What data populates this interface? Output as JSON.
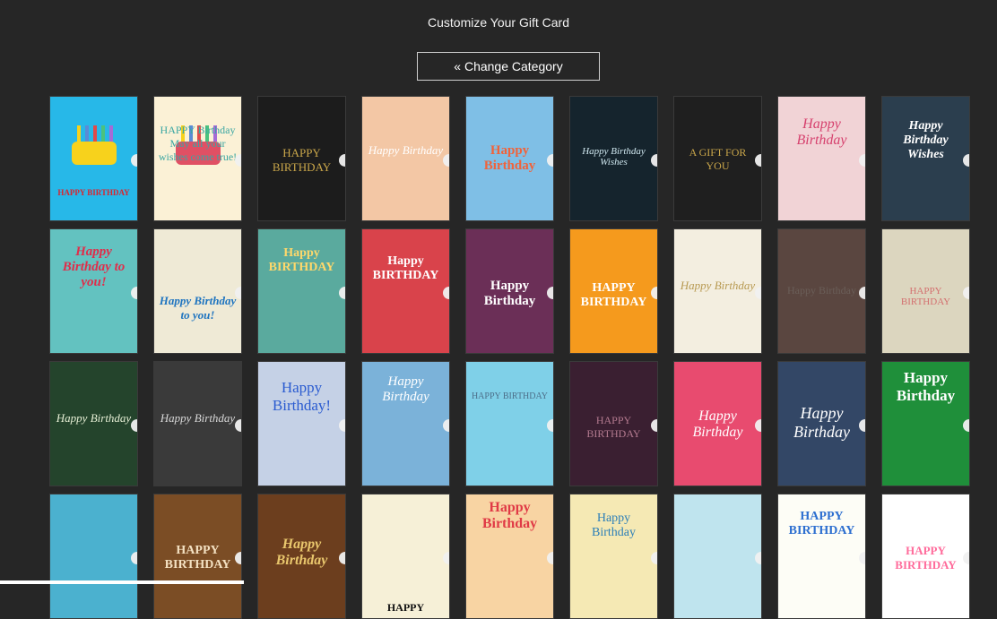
{
  "header": {
    "title": "Customize Your Gift Card"
  },
  "toolbar": {
    "change_category_label": "« Change Category"
  },
  "cards": [
    {
      "text": "HAPPY BIRTHDAY",
      "bg": "#27b8e8",
      "fg": "#d8262f",
      "font": "bold 9px",
      "top": "74%",
      "icon": "cake"
    },
    {
      "text": "HAPPY Birthday May all your wishes come true!",
      "bg": "#fbf1d6",
      "fg": "#3aa6a3",
      "font": "12px",
      "top": "22%",
      "icon": "cake2"
    },
    {
      "text": "HAPPY BIRTHDAY",
      "bg": "#1c1c1c",
      "fg": "#c9a64a",
      "font": "13px",
      "top": "40%"
    },
    {
      "text": "Happy Birthday",
      "bg": "#f3c7a5",
      "fg": "#ffffff",
      "font": "italic 13px",
      "top": "38%"
    },
    {
      "text": "Happy Birthday",
      "bg": "#7fbfe6",
      "fg": "#f0633b",
      "font": "bold 15px",
      "top": "38%"
    },
    {
      "text": "Happy Birthday Wishes",
      "bg": "#15242d",
      "fg": "#cfe7ef",
      "font": "italic 11px",
      "top": "40%"
    },
    {
      "text": "A GIFT FOR YOU",
      "bg": "#1f1f1f",
      "fg": "#c9a64a",
      "font": "12px",
      "top": "40%"
    },
    {
      "text": "Happy Birthday",
      "bg": "#f1d3d6",
      "fg": "#d6416e",
      "font": "italic 16px",
      "top": "16%"
    },
    {
      "text": "Happy Birthday Wishes",
      "bg": "#2b3e4e",
      "fg": "#ffffff",
      "font": "italic bold 14px",
      "top": "18%"
    },
    {
      "text": "Happy Birthday to you!",
      "bg": "#63c2c0",
      "fg": "#e02d4a",
      "font": "italic bold 15px",
      "top": "12%"
    },
    {
      "text": "Happy Birthday to you!",
      "bg": "#efead6",
      "fg": "#1e74c0",
      "font": "italic bold 13px",
      "top": "52%"
    },
    {
      "text": "Happy BIRTHDAY",
      "bg": "#5aaa9e",
      "fg": "#ffd86b",
      "font": "bold 14px",
      "top": "14%"
    },
    {
      "text": "Happy BIRTHDAY",
      "bg": "#d9434b",
      "fg": "#ffffff",
      "font": "bold 14px",
      "top": "20%"
    },
    {
      "text": "Happy Birthday",
      "bg": "#6b2f57",
      "fg": "#ffffff",
      "font": "bold 15px",
      "top": "40%"
    },
    {
      "text": "HAPPY BIRTHDAY",
      "bg": "#f59a1d",
      "fg": "#ffffff",
      "font": "bold 14px",
      "top": "42%"
    },
    {
      "text": "Happy Birthday",
      "bg": "#f3eee0",
      "fg": "#b89a52",
      "font": "italic 13px",
      "top": "40%"
    },
    {
      "text": "Happy Birthday",
      "bg": "#5a4640",
      "fg": "#6a5e58",
      "font": "12px",
      "top": "44%"
    },
    {
      "text": "HAPPY BIRTHDAY",
      "bg": "#dcd6bf",
      "fg": "#d3706f",
      "font": "11px",
      "top": "46%"
    },
    {
      "text": "Happy Birthday",
      "bg": "#24442c",
      "fg": "#e6efd5",
      "font": "italic 13px",
      "top": "40%"
    },
    {
      "text": "Happy Birthday",
      "bg": "#3a3a3a",
      "fg": "#d8d8d8",
      "font": "italic 13px",
      "top": "40%"
    },
    {
      "text": "Happy Birthday!",
      "bg": "#c5d1e6",
      "fg": "#2a5bd0",
      "font": "17px",
      "top": "14%"
    },
    {
      "text": "Happy Birthday",
      "bg": "#7bb2d9",
      "fg": "#ffffff",
      "font": "italic 15px",
      "top": "10%"
    },
    {
      "text": "HAPPY BIRTHDAY",
      "bg": "#7fd0e8",
      "fg": "#4d6f8a",
      "font": "10px",
      "top": "24%"
    },
    {
      "text": "HAPPY BIRTHDAY",
      "bg": "#3a1f31",
      "fg": "#b37a8f",
      "font": "12px",
      "top": "42%"
    },
    {
      "text": "Happy Birthday",
      "bg": "#e84b6f",
      "fg": "#ffffff",
      "font": "italic 16px",
      "top": "38%"
    },
    {
      "text": "Happy Birthday",
      "bg": "#334766",
      "fg": "#ffffff",
      "font": "italic 18px",
      "top": "34%"
    },
    {
      "text": "Happy Birthday",
      "bg": "#1f8f3a",
      "fg": "#ffffff",
      "font": "bold 17px",
      "top": "6%"
    },
    {
      "text": "",
      "bg": "#4bb1cf",
      "fg": "#ffffff",
      "font": "12px",
      "top": "40%"
    },
    {
      "text": "HAPPY BIRTHDAY",
      "bg": "#7b4d25",
      "fg": "#f4e1c2",
      "font": "bold 14px",
      "top": "40%"
    },
    {
      "text": "Happy Birthday",
      "bg": "#6c3e1e",
      "fg": "#e9c76d",
      "font": "italic bold 16px",
      "top": "34%"
    },
    {
      "text": "HAPPY",
      "bg": "#f6f0d7",
      "fg": "#111111",
      "font": "bold 12px",
      "top": "86%"
    },
    {
      "text": "Happy Birthday",
      "bg": "#f8d4a3",
      "fg": "#e03a46",
      "font": "bold 16px",
      "top": "4%"
    },
    {
      "text": "Happy Birthday",
      "bg": "#f5e9b4",
      "fg": "#2c7fb8",
      "font": "14px",
      "top": "14%"
    },
    {
      "text": "",
      "bg": "#bfe4ee",
      "fg": "#2c7fb8",
      "font": "14px",
      "top": "14%"
    },
    {
      "text": "HAPPY BIRTHDAY",
      "bg": "#fdfdf6",
      "fg": "#2d6fd0",
      "font": "bold 14px",
      "top": "12%"
    },
    {
      "text": "HAPPY BIRTHDAY",
      "bg": "#ffffff",
      "fg": "#ff6b9b",
      "font": "bold 13px",
      "top": "40%"
    }
  ]
}
